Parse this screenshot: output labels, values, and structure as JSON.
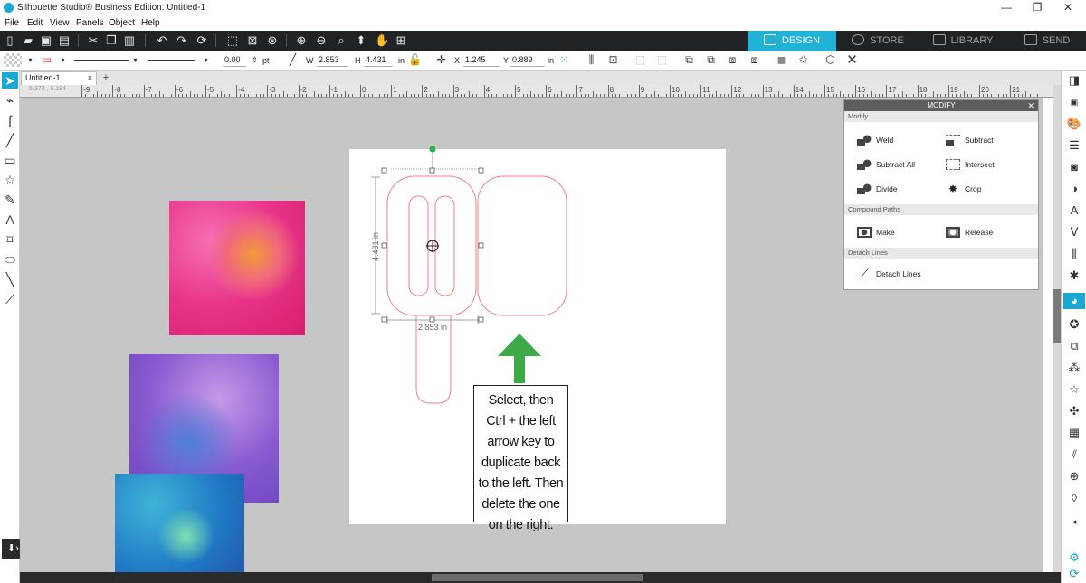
{
  "window": {
    "title": "Silhouette Studio® Business Edition: Untitled-1",
    "minimize": "—",
    "restore": "❐",
    "close": "✕"
  },
  "menu": [
    "File",
    "Edit",
    "View",
    "Panels",
    "Object",
    "Help"
  ],
  "nav_tabs": {
    "design": "DESIGN",
    "store": "STORE",
    "library": "LIBRARY",
    "send": "SEND"
  },
  "toolbar2": {
    "line_width": "0.00",
    "line_unit": "pt",
    "w_label": "W",
    "w_value": "2.853",
    "h_label": "H",
    "h_value": "4.431",
    "h_unit": "in",
    "x_label": "X",
    "x_value": "1.245",
    "y_label": "Y",
    "y_value": "0.889",
    "y_unit": "in"
  },
  "doc_tab": {
    "name": "Untitled-1",
    "close": "×",
    "add": "+"
  },
  "ruler": {
    "readout": "5.373 , 6.194",
    "labels": [
      "-9",
      "-8",
      "-7",
      "-6",
      "-5",
      "-4",
      "-3",
      "-2",
      "-1",
      "0",
      "1",
      "2",
      "3",
      "4",
      "5",
      "6",
      "7",
      "8",
      "9",
      "10",
      "11",
      "12",
      "13",
      "14",
      "15",
      "16",
      "17",
      "18",
      "19",
      "20",
      "21"
    ]
  },
  "dims": {
    "width": "2.853 in",
    "height": "4.431 in"
  },
  "callout": {
    "lines": [
      "Select, then",
      "Ctrl + the left",
      "arrow key to",
      "duplicate back",
      "to the left. Then",
      "delete the one",
      "on the right."
    ]
  },
  "modify_panel": {
    "title": "MODIFY",
    "close": "✕",
    "section_modify": "Modify",
    "weld": "Weld",
    "subtract": "Subtract",
    "subtract_all": "Subtract All",
    "intersect": "Intersect",
    "divide": "Divide",
    "crop": "Crop",
    "section_compound": "Compound Paths",
    "make": "Make",
    "release": "Release",
    "section_detach": "Detach Lines",
    "detach_lines": "Detach Lines"
  },
  "colors": {
    "accent": "#1fb1d6",
    "shape_stroke": "#f08080",
    "arrow": "#3daa47",
    "handle": "#22b14c"
  }
}
